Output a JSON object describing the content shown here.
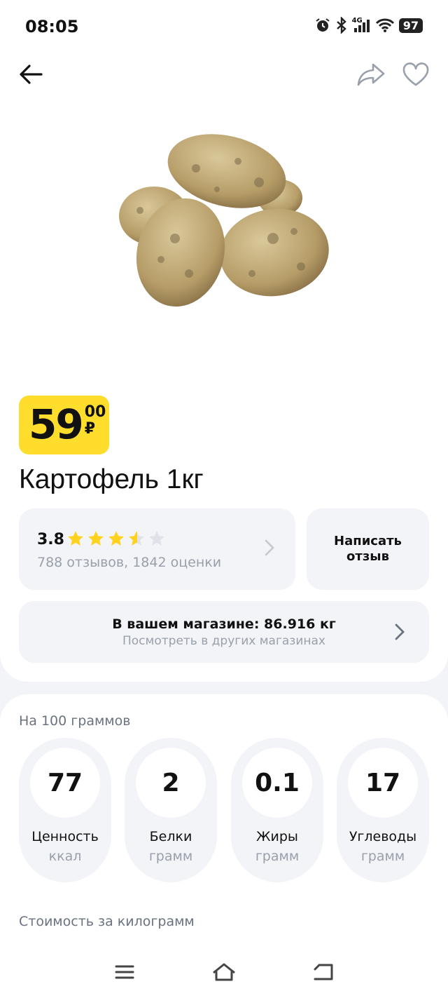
{
  "status_bar": {
    "time": "08:05",
    "network": "4G",
    "battery": "97"
  },
  "product": {
    "price_main": "59",
    "price_kopecks": "00",
    "currency": "₽",
    "title": "Картофель 1кг",
    "image": "potatoes-photo"
  },
  "rating": {
    "score": "3.8",
    "stars_value": 3.8,
    "stars_max": 5,
    "count_text": "788 отзывов, 1842 оценки"
  },
  "write_review": {
    "label": "Написать отзыв"
  },
  "store": {
    "main": "В вашем магазине: 86.916 кг",
    "sub": "Посмотреть в других магазинах"
  },
  "nutrition": {
    "heading": "На 100 граммов",
    "items": [
      {
        "value": "77",
        "label": "Ценность",
        "unit": "ккал"
      },
      {
        "value": "2",
        "label": "Белки",
        "unit": "грамм"
      },
      {
        "value": "0.1",
        "label": "Жиры",
        "unit": "грамм"
      },
      {
        "value": "17",
        "label": "Углеводы",
        "unit": "грамм"
      }
    ]
  },
  "cost_per_kg": {
    "label": "Стоимость за килограмм"
  },
  "colors": {
    "price_badge": "#ffdd2d",
    "star": "#ffd21f",
    "star_empty": "#dfe2e8",
    "muted": "#9aa0ab"
  },
  "icons": [
    "back-arrow-icon",
    "share-icon",
    "heart-icon",
    "star-icon",
    "chevron-right-icon",
    "menu-icon",
    "home-icon",
    "return-icon"
  ]
}
